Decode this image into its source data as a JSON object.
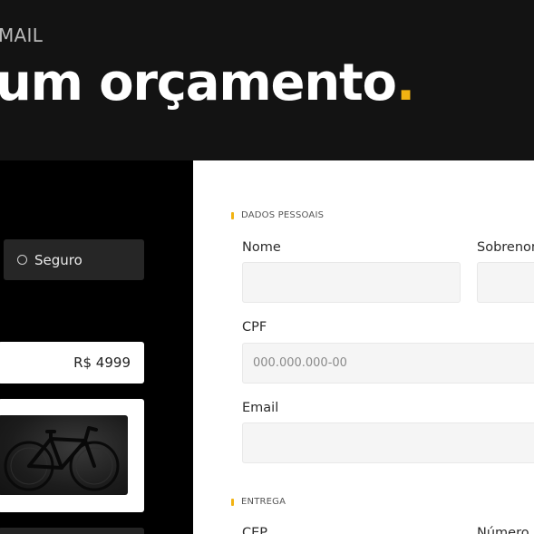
{
  "header": {
    "eyebrow": "MAIL",
    "headline": "um orçamento",
    "headline_dot": "."
  },
  "left_panel": {
    "option_button": {
      "label": "Seguro",
      "selected": false
    },
    "price": "R$ 4999",
    "product_image": "bicycle-photo"
  },
  "form": {
    "sections": {
      "personal": "DADOS PESSOAIS",
      "delivery": "ENTREGA"
    },
    "fields": {
      "nome": {
        "label": "Nome",
        "value": "",
        "placeholder": ""
      },
      "sobrenome": {
        "label": "Sobrenome",
        "value": "",
        "placeholder": ""
      },
      "cpf": {
        "label": "CPF",
        "value": "",
        "placeholder": "000.000.000-00"
      },
      "email": {
        "label": "Email",
        "value": "",
        "placeholder": ""
      },
      "cep": {
        "label": "CEP"
      },
      "numero": {
        "label": "Número"
      }
    }
  },
  "colors": {
    "accent": "#f2b312",
    "header_bg": "#131313",
    "panel_bg": "#000000",
    "input_bg": "#f5f5f5"
  }
}
